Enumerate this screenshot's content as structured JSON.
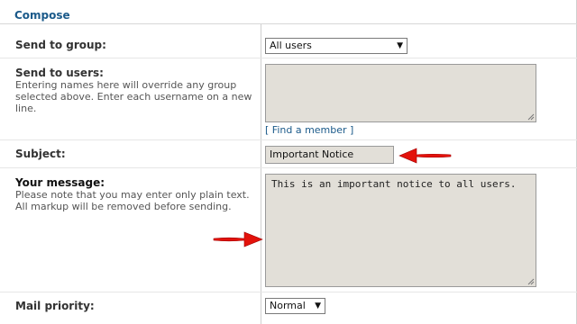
{
  "section": {
    "legend": "Compose"
  },
  "send_to_group": {
    "label": "Send to group:",
    "selected": "All users"
  },
  "send_to_users": {
    "label": "Send to users:",
    "help": "Entering names here will override any group selected above. Enter each username on a new line.",
    "value": "",
    "find_member_prefix": "[ ",
    "find_member_link": "Find a member",
    "find_member_suffix": " ]"
  },
  "subject": {
    "label": "Subject:",
    "value": "Important Notice"
  },
  "message": {
    "label": "Your message:",
    "help": "Please note that you may enter only plain text. All markup will be removed before sending.",
    "value": "This is an important notice to all users."
  },
  "mail_priority": {
    "label": "Mail priority:",
    "selected": "Normal"
  },
  "colors": {
    "legend": "#1b5a8a",
    "link": "#1b5a8a",
    "field_bg": "#e2dfd8",
    "arrow": "#e3120b"
  },
  "icons": {
    "dropdown": "triangle-down-icon",
    "annotation": "red-arrow-icon"
  }
}
